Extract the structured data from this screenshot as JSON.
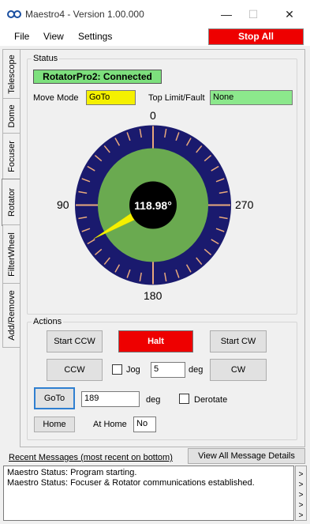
{
  "window": {
    "title": "Maestro4 - Version 1.00.000",
    "minimize": "—",
    "maximize": "☐",
    "close": "✕"
  },
  "menu": {
    "file": "File",
    "view": "View",
    "settings": "Settings",
    "stop_all": "Stop All"
  },
  "tabs": [
    "Telescope",
    "Dome",
    "Focuser",
    "Rotator",
    "FilterWheel",
    "Add/Remove"
  ],
  "active_tab": "Rotator",
  "status": {
    "group_label": "Status",
    "connection": "RotatorPro2: Connected",
    "move_mode_label": "Move Mode",
    "move_mode_value": "GoTo",
    "top_limit_label": "Top Limit/Fault",
    "top_limit_value": "None"
  },
  "dial": {
    "angle_text": "118.98°",
    "angle_value": 118.98,
    "label_top": "0",
    "label_left": "90",
    "label_right": "270",
    "label_bottom": "180"
  },
  "actions": {
    "group_label": "Actions",
    "start_ccw": "Start CCW",
    "halt": "Halt",
    "start_cw": "Start CW",
    "ccw": "CCW",
    "jog_label": "Jog",
    "jog_value": "5",
    "jog_unit": "deg",
    "cw": "CW",
    "goto": "GoTo",
    "goto_value": "189",
    "goto_unit": "deg",
    "derotate_label": "Derotate",
    "home": "Home",
    "at_home_label": "At Home",
    "at_home_value": "No"
  },
  "messages": {
    "header": "Recent Messages (most recent on bottom)",
    "view_all": "View All Message Details",
    "lines": [
      "Maestro Status: Program starting.",
      "Maestro Status: Focuser & Rotator communications established."
    ]
  },
  "colors": {
    "dial_outer": "#1a1a6e",
    "dial_inner": "#6aaa50",
    "tick": "#e8a87c",
    "pointer": "#f5f000",
    "halt": "#ee0000",
    "connected": "#7de07d",
    "move_mode": "#f5f000",
    "limit_ok": "#8ce88c"
  }
}
